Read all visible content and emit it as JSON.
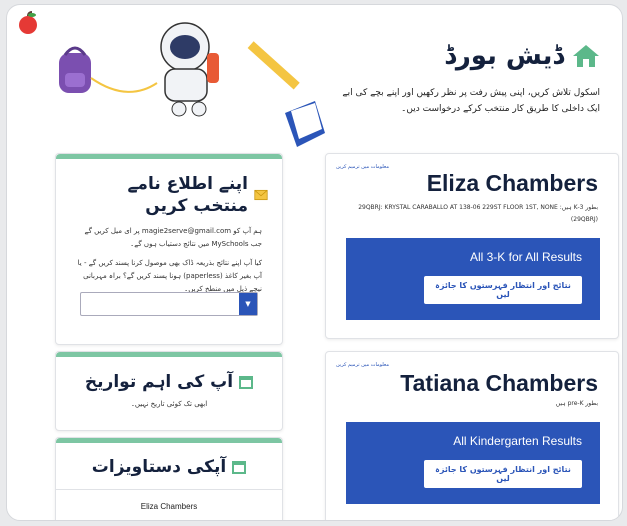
{
  "header": {
    "title": "ڈیش بورڈ",
    "description": "اسکول تلاش کریں، اپنی پیش رفت پر نظر رکھیں اور اپنے بچے کی ابے ایک داخلی کا طریق کار منتخب کرکے درخواست دیں۔"
  },
  "notify": {
    "title": "اپنے اطلاع نامے منتخب کریں",
    "line1": "ہم آپ کو magie2serve@gmail.com پر ای میل کریں گے جب MySchools میں نتائج دستیاب ہوں گے۔",
    "line2": "کیا آپ اپنے نتائج بذریعہ ڈاک بھی موصول کرنا پسند کریں گے - یا آپ بغیر کاغذ (paperless) ہونا پسند کریں گے؟ براہ مہربانی نیچے ذیل میں منطخ کریں۔",
    "select_value": ""
  },
  "dates": {
    "title": "آپ کی اہم تواریخ",
    "empty": "ابھی تک کوئی تاریخ نہیں۔"
  },
  "docs": {
    "title": "آپکی دستاویزات",
    "first_name": "Eliza Chambers"
  },
  "students": [
    {
      "edit_link": "معلومات میں ترمیم کریں",
      "name": "Eliza Chambers",
      "info": "بطور 3-K ہیں: 29QBRJ: KRYSTAL CARABALLO AT 138-06 229ST FLOOR 1ST, NONE (29QBRJ)",
      "results_label": "All 3-K for All Results",
      "button_label": "نتائج اور انتظار فہرستوں کا جائزہ لیں"
    },
    {
      "edit_link": "معلومات میں ترمیم کریں",
      "name": "Tatiana Chambers",
      "info": "بطور pre-K ہیں",
      "results_label": "All Kindergarten Results",
      "button_label": "نتائج اور انتظار فہرستوں کا جائزہ لیں"
    }
  ],
  "colors": {
    "accent": "#2b55b8",
    "green": "#7dc6a3",
    "navy": "#14213d"
  }
}
